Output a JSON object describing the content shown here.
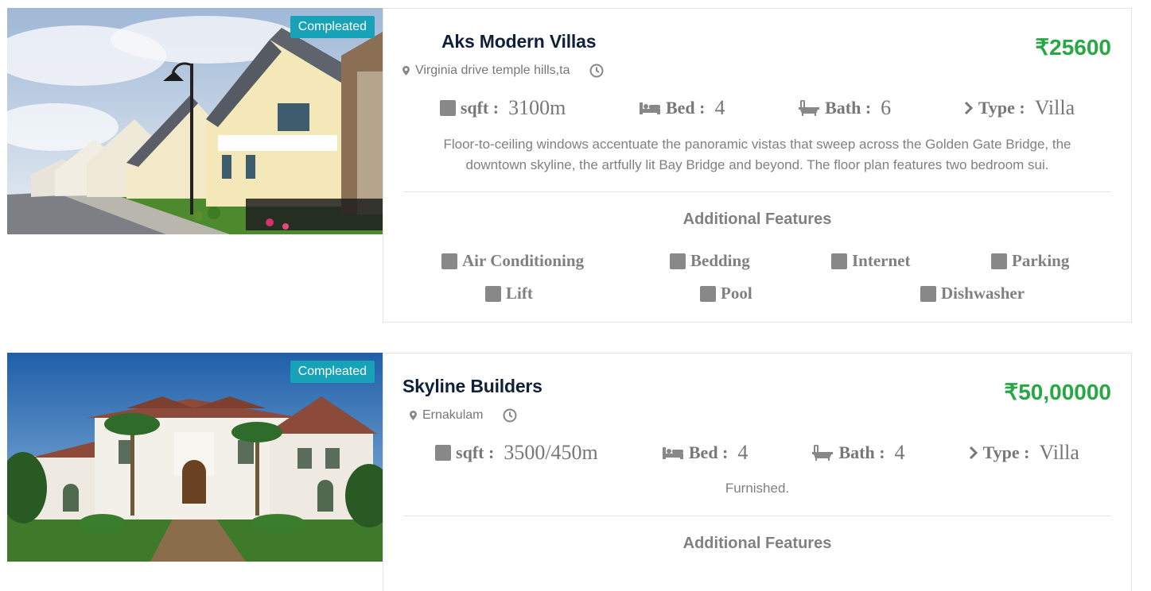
{
  "colors": {
    "badge": "#17a2b8",
    "price": "#28a745",
    "title": "#10203a",
    "muted": "#808080"
  },
  "listings": [
    {
      "status": "Compleated",
      "title": "Aks Modern Villas",
      "price": "₹25600",
      "location": "Virginia drive temple hills,ta",
      "specs": {
        "sqft_label": "sqft :",
        "sqft_value": "3100m",
        "bed_label": "Bed :",
        "bed_value": "4",
        "bath_label": "Bath :",
        "bath_value": "6",
        "type_label": "Type :",
        "type_value": "Villa"
      },
      "description_line1": "Floor-to-ceiling windows accentuate the panoramic vistas that sweep across the Golden Gate Bridge, the",
      "description_line2": "downtown skyline, the artfully lit Bay Bridge and beyond. The floor plan features two bedroom sui.",
      "features_title": "Additional Features",
      "features": [
        "Air Conditioning",
        "Bedding",
        "Internet",
        "Parking",
        "Lift",
        "Pool",
        "Dishwasher"
      ]
    },
    {
      "status": "Compleated",
      "title": "Skyline Builders",
      "price": "₹50,00000",
      "location": "Ernakulam",
      "specs": {
        "sqft_label": "sqft :",
        "sqft_value": "3500/450m",
        "bed_label": "Bed :",
        "bed_value": "4",
        "bath_label": "Bath :",
        "bath_value": "4",
        "type_label": "Type :",
        "type_value": "Villa"
      },
      "description": "Furnished.",
      "features_title": "Additional Features"
    }
  ],
  "icons": [
    "map-pin-icon",
    "clock-icon",
    "area-square-icon",
    "bed-icon",
    "bathtub-icon",
    "chevron-right-icon",
    "feature-checkbox-icon"
  ]
}
